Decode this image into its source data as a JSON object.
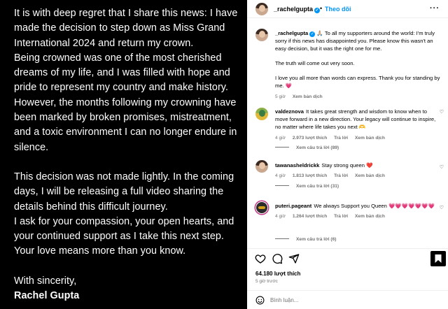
{
  "post_image": {
    "paragraph_1": "It is with deep regret that I share this news: I have\nmade the decision to step down as Miss Grand\nInternational 2024 and return my crown.\nBeing crowned was one of the most cherished\ndreams of my life, and I was filled with hope and\npride to represent my country and make history.\nHowever, the months following my crowning have\nbeen marked by broken promises, mistreatment,\nand a toxic environment I can no longer endure in\nsilence.",
    "paragraph_2": "This decision was not made lightly. In the coming\ndays, I will be releasing a full video sharing the\ndetails behind this difficult journey.\nI ask for your compassion, your open hearts, and\nyour continued support as I take this next step.\nYour love means more than you know.",
    "signoff": "With sincerity,",
    "signature": "Rachel Gupta"
  },
  "header": {
    "username": "_rachelgupta",
    "separator": "•",
    "follow_label": "Theo dõi",
    "more_icon": "more-horizontal-icon"
  },
  "caption": {
    "username": "_rachelgupta",
    "line_1": "🙏🏼 To all my supporters around the world: I'm truly sorry if this news has disappointed you. Please know this wasn't an easy decision, but it was the right one for me.",
    "line_2": "The truth will come out very soon.",
    "line_3": "I love you all more than words can express. Thank you for standing by me. 💗",
    "time": "5 giờ",
    "translate": "Xem bản dịch"
  },
  "comments": [
    {
      "username": "valdeznova",
      "text": "It takes great strength and wisdom to know when to move forward in a new direction. Your legacy will continue to inspire, no matter where life takes you next 🫶",
      "time": "4 giờ",
      "likes": "2.973 lượt thích",
      "reply": "Trả lời",
      "translate": "Xem bản dịch",
      "view_replies": "Xem câu trả lời (89)"
    },
    {
      "username": "tawanasheldrickk",
      "text": "Stay strong queen ❤️",
      "time": "4 giờ",
      "likes": "1.813 lượt thích",
      "reply": "Trả lời",
      "translate": "Xem bản dịch",
      "view_replies": "Xem câu trả lời (31)"
    },
    {
      "username": "puteri.pageant",
      "text": "We always Support you Queen 💗💗💗💗💗💗💗",
      "time": "4 giờ",
      "likes": "1.264 lượt thích",
      "reply": "Trả lời",
      "translate": "Xem bản dịch",
      "view_replies": "Xem câu trả lời (6)"
    }
  ],
  "actions": {
    "likes": "64.180 lượt thích",
    "time": "5 giờ trước"
  },
  "add_comment": {
    "placeholder": "Bình luận..."
  },
  "colors": {
    "accent": "#0095f6",
    "muted": "#737373",
    "image_bg": "#000000"
  }
}
